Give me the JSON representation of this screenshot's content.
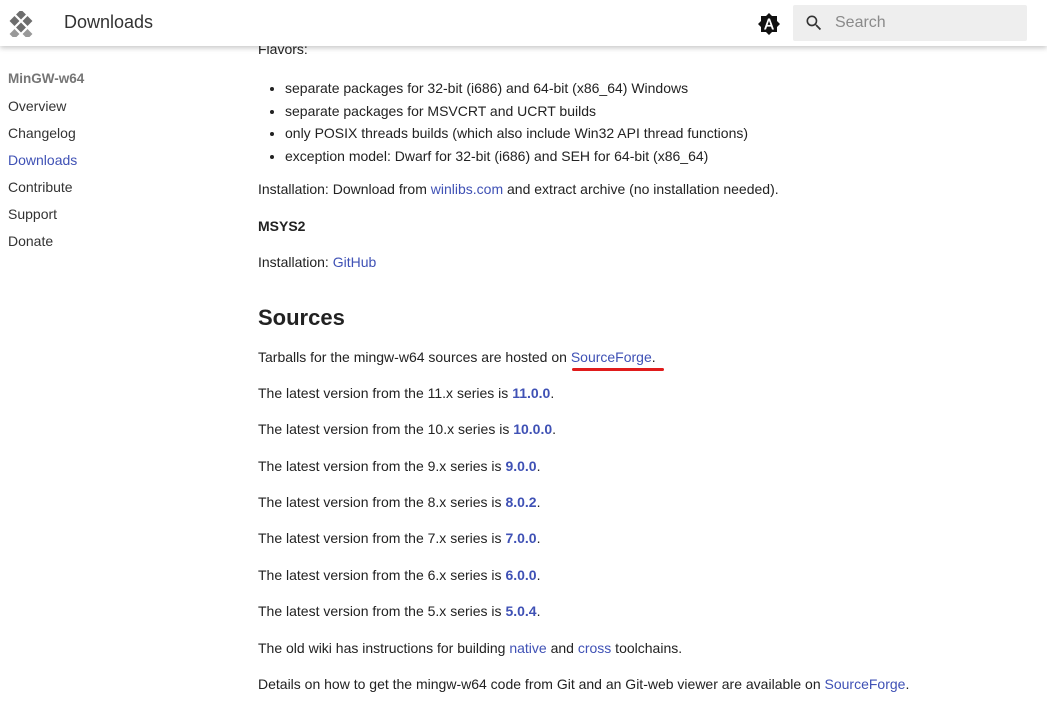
{
  "header": {
    "title": "Downloads",
    "search_placeholder": "Search"
  },
  "sidebar": {
    "heading": "MinGW-w64",
    "items": [
      {
        "label": "Overview",
        "active": false
      },
      {
        "label": "Changelog",
        "active": false
      },
      {
        "label": "Downloads",
        "active": true
      },
      {
        "label": "Contribute",
        "active": false
      },
      {
        "label": "Support",
        "active": false
      },
      {
        "label": "Donate",
        "active": false
      }
    ]
  },
  "content": {
    "flavors_label": "Flavors:",
    "flavors": [
      "separate packages for 32-bit (i686) and 64-bit (x86_64) Windows",
      "separate packages for MSVCRT and UCRT builds",
      "only POSIX threads builds (which also include Win32 API thread functions)",
      "exception model: Dwarf for 32-bit (i686) and SEH for 64-bit (x86_64)"
    ],
    "installation_winlibs": {
      "prefix": "Installation: Download from ",
      "link": "winlibs.com",
      "suffix": " and extract archive (no installation needed)."
    },
    "msys2_heading": "MSYS2",
    "installation_github": {
      "prefix": "Installation: ",
      "link": "GitHub"
    },
    "sources_heading": "Sources",
    "tarballs": {
      "prefix": "Tarballs for the mingw-w64 sources are hosted on ",
      "link": "SourceForge",
      "suffix": "."
    },
    "versions": [
      {
        "prefix": "The latest version from the 11.x series is ",
        "version": "11.0.0"
      },
      {
        "prefix": "The latest version from the 10.x series is ",
        "version": "10.0.0"
      },
      {
        "prefix": "The latest version from the 9.x series is ",
        "version": "9.0.0"
      },
      {
        "prefix": "The latest version from the 8.x series is ",
        "version": "8.0.2"
      },
      {
        "prefix": "The latest version from the 7.x series is ",
        "version": "7.0.0"
      },
      {
        "prefix": "The latest version from the 6.x series is ",
        "version": "6.0.0"
      },
      {
        "prefix": "The latest version from the 5.x series is ",
        "version": "5.0.4"
      }
    ],
    "version_suffix": ".",
    "wiki": {
      "prefix": "The old wiki has instructions for building ",
      "link1": "native",
      "middle": " and ",
      "link2": "cross",
      "suffix": " toolchains."
    },
    "git": {
      "prefix": "Details on how to get the mingw-w64 code from Git and an Git-web viewer are available on ",
      "link": "SourceForge",
      "suffix": "."
    }
  },
  "colors": {
    "link": "#3f51b5",
    "annotation_underline": "#e01b1b"
  }
}
